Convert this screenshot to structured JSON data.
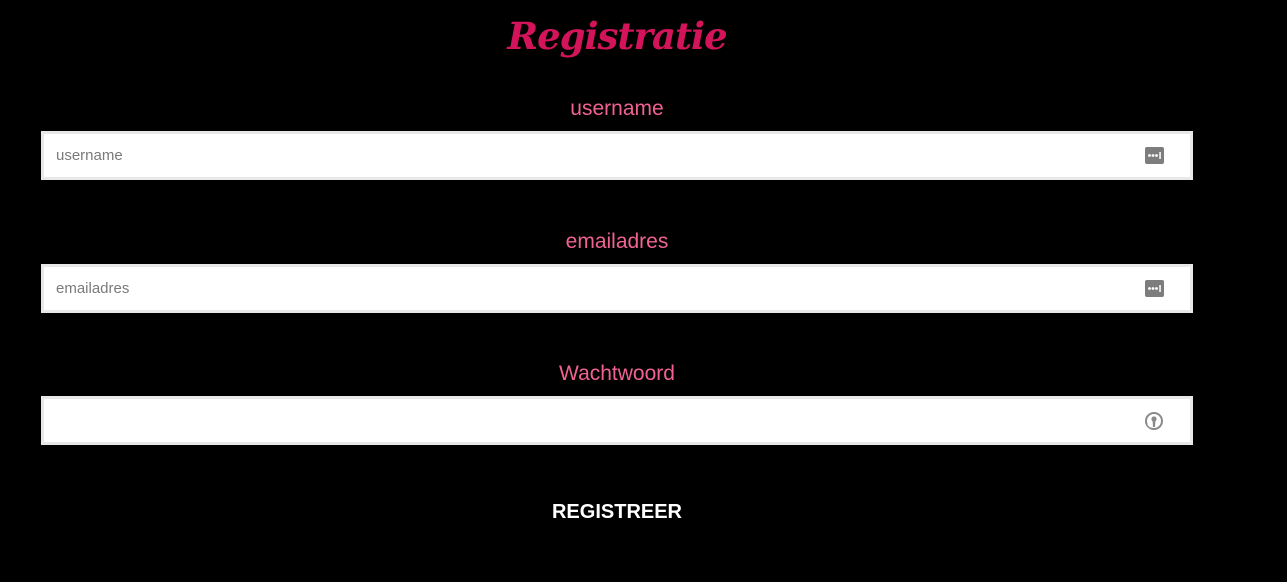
{
  "page": {
    "title": "Registratie"
  },
  "form": {
    "username": {
      "label": "username",
      "placeholder": "username",
      "value": "",
      "icon": "password-manager-icon"
    },
    "email": {
      "label": "emailadres",
      "placeholder": "emailadres",
      "value": "",
      "icon": "password-manager-icon"
    },
    "password": {
      "label": "Wachtwoord",
      "placeholder": "",
      "value": "",
      "icon": "key-generator-icon"
    },
    "submit_label": "REGISTREER"
  },
  "colors": {
    "background": "#000000",
    "title": "#d4145a",
    "label": "#f06292",
    "input_background": "#ffffff",
    "input_border": "#e8e8e8",
    "button_text": "#ffffff"
  }
}
